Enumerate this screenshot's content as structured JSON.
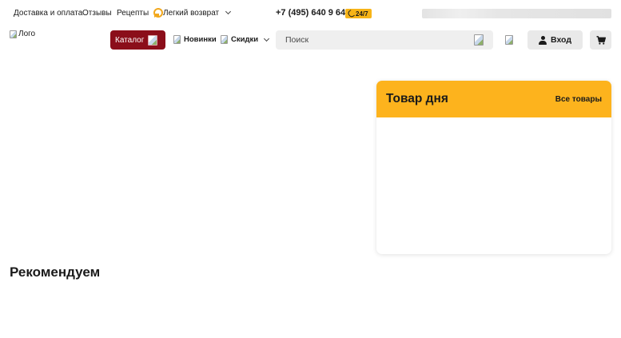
{
  "topbar": {
    "links": [
      "Доставка и оплата",
      "Отзывы",
      "Рецепты"
    ],
    "return_label": "Легкий возврат",
    "phone": "+7 (495) 640 9 640",
    "hours_badge": "24/7"
  },
  "header": {
    "logo_alt": "Лого",
    "catalog_label": "Каталог",
    "nav": {
      "new_label": "Новинки",
      "sales_label": "Скидки"
    },
    "search": {
      "placeholder": "Поиск"
    },
    "login_label": "Вход"
  },
  "deal_of_day": {
    "title": "Товар дня",
    "all_link": "Все товары"
  },
  "recommend": {
    "title": "Рекомендуем"
  },
  "colors": {
    "brand_red": "#8b0e1a",
    "accent_yellow": "#fdb31d",
    "button_gray": "#e9e9e9"
  }
}
